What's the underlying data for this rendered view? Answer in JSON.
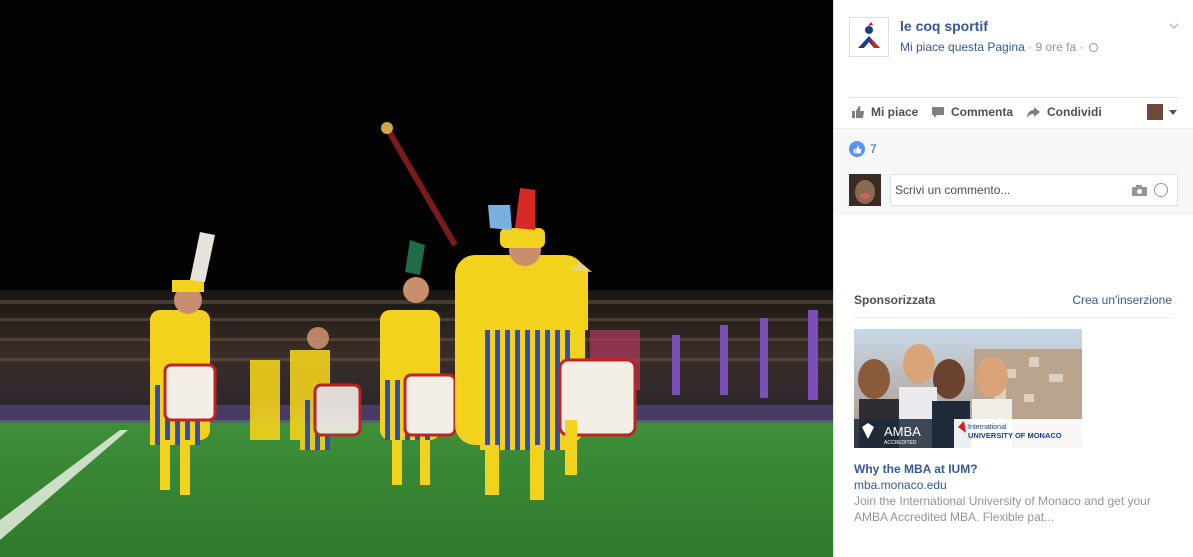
{
  "post": {
    "page_name": "le coq sportif",
    "like_page_label": "Mi piace questa Pagina",
    "time_ago": "9 ore fa",
    "separator": "·"
  },
  "actions": {
    "like_label": "Mi piace",
    "comment_label": "Commenta",
    "share_label": "Condividi"
  },
  "feedback": {
    "like_count": "7",
    "comment_placeholder": "Scrivi un commento..."
  },
  "sponsored": {
    "header": "Sponsorizzata",
    "create_ad": "Crea un'inserzione",
    "ad": {
      "image_badge_logo": "AMBA",
      "image_badge_sub": "ACCREDITED",
      "image_brand_line1": "International",
      "image_brand_line2": "UNIVERSITY OF MONACO",
      "title": "Why the MBA at IUM?",
      "domain": "mba.monaco.edu",
      "description": "Join the International University of Monaco and get your AMBA Accredited MBA. Flexible pat..."
    }
  },
  "icons": {
    "like": "thumbs-up-icon",
    "comment": "comment-bubble-icon",
    "share": "share-arrow-icon",
    "privacy": "globe-icon",
    "camera": "camera-icon",
    "emoji": "smile-icon"
  },
  "colors": {
    "link": "#365899",
    "muted": "#90949c",
    "action_text": "#4b4f56",
    "like_blue": "#5890ff",
    "panel_gray": "#f6f7f9"
  }
}
